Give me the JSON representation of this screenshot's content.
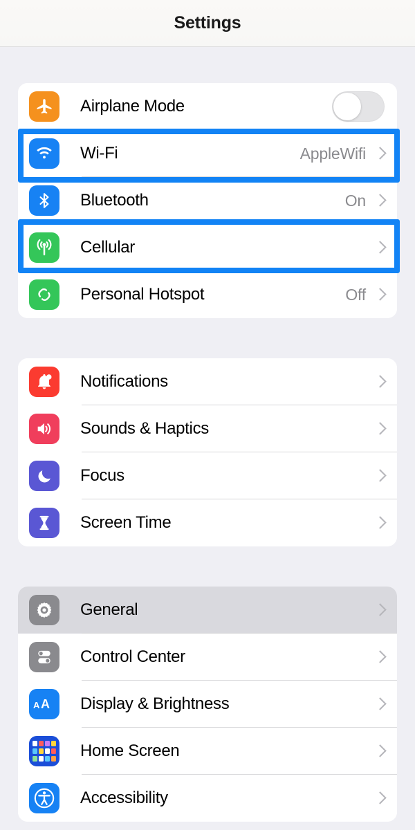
{
  "header": {
    "title": "Settings"
  },
  "groups": [
    {
      "id": "connectivity",
      "rows": [
        {
          "label": "Airplane Mode",
          "icon": "airplane-icon",
          "icon_color": "#F5911E",
          "control": "toggle",
          "toggle_on": false,
          "value": "",
          "annotated": false
        },
        {
          "label": "Wi-Fi",
          "icon": "wifi-icon",
          "icon_color": "#1782F4",
          "control": "chevron",
          "value": "AppleWifi",
          "annotated": true
        },
        {
          "label": "Bluetooth",
          "icon": "bluetooth-icon",
          "icon_color": "#1782F4",
          "control": "chevron",
          "value": "On",
          "annotated": false
        },
        {
          "label": "Cellular",
          "icon": "cellular-antenna-icon",
          "icon_color": "#34C659",
          "control": "chevron",
          "value": "",
          "annotated": true
        },
        {
          "label": "Personal Hotspot",
          "icon": "hotspot-link-icon",
          "icon_color": "#34C659",
          "control": "chevron",
          "value": "Off",
          "annotated": false
        }
      ]
    },
    {
      "id": "alerts",
      "rows": [
        {
          "label": "Notifications",
          "icon": "bell-icon",
          "icon_color": "#FB3B30",
          "control": "chevron",
          "value": "",
          "annotated": false
        },
        {
          "label": "Sounds & Haptics",
          "icon": "speaker-waves-icon",
          "icon_color": "#F03E5C",
          "control": "chevron",
          "value": "",
          "annotated": false
        },
        {
          "label": "Focus",
          "icon": "moon-icon",
          "icon_color": "#5A57D4",
          "control": "chevron",
          "value": "",
          "annotated": false
        },
        {
          "label": "Screen Time",
          "icon": "hourglass-icon",
          "icon_color": "#5A57D4",
          "control": "chevron",
          "value": "",
          "annotated": false
        }
      ]
    },
    {
      "id": "system",
      "rows": [
        {
          "label": "General",
          "icon": "gear-icon",
          "icon_color": "#8A8A8E",
          "control": "chevron",
          "value": "",
          "annotated": false,
          "pressed": true
        },
        {
          "label": "Control Center",
          "icon": "sliders-icon",
          "icon_color": "#8A8A8E",
          "control": "chevron",
          "value": "",
          "annotated": false
        },
        {
          "label": "Display & Brightness",
          "icon": "text-size-icon",
          "icon_color": "#1782F4",
          "control": "chevron",
          "value": "",
          "annotated": false
        },
        {
          "label": "Home Screen",
          "icon": "app-grid-icon",
          "icon_color": "#1B4ED8",
          "control": "chevron",
          "value": "",
          "annotated": false
        },
        {
          "label": "Accessibility",
          "icon": "accessibility-person-icon",
          "icon_color": "#1782F4",
          "control": "chevron",
          "value": "",
          "annotated": false
        }
      ]
    }
  ],
  "annotations": {
    "color": "#1283F5",
    "targets": [
      "Wi-Fi",
      "Cellular"
    ]
  }
}
